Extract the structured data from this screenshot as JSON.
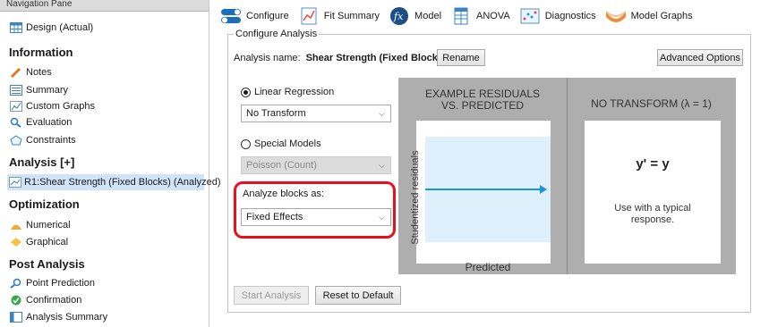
{
  "nav": {
    "title": "Navigation Pane",
    "design": "Design (Actual)",
    "info_head": "Information",
    "info_items": [
      "Notes",
      "Summary",
      "Custom Graphs",
      "Evaluation",
      "Constraints"
    ],
    "analysis_head": "Analysis [+]",
    "analysis_item": "R1:Shear Strength (Fixed Blocks) (Analyzed)",
    "opt_head": "Optimization",
    "opt_items": [
      "Numerical",
      "Graphical"
    ],
    "post_head": "Post Analysis",
    "post_items": [
      "Point Prediction",
      "Confirmation",
      "Analysis Summary"
    ]
  },
  "tabs": [
    "Configure",
    "Fit Summary",
    "Model",
    "ANOVA",
    "Diagnostics",
    "Model Graphs"
  ],
  "configure": {
    "legend": "Configure Analysis",
    "name_label": "Analysis name:",
    "name_value": "Shear Strength (Fixed Blocks)",
    "rename": "Rename",
    "advanced": "Advanced Options",
    "linear": "Linear Regression",
    "transform": "No Transform",
    "special": "Special Models",
    "special_value": "Poisson (Count)",
    "blocks_label": "Analyze blocks as:",
    "blocks_value": "Fixed Effects",
    "start": "Start Analysis",
    "reset": "Reset to Default"
  },
  "diagram": {
    "left_title_1": "EXAMPLE RESIDUALS",
    "left_title_2": "VS. PREDICTED",
    "y_label": "Studentized residuals",
    "x_label": "Predicted",
    "right_title": "NO TRANSFORM (λ = 1)",
    "equation": "y' = y",
    "desc": "Use with a typical response."
  },
  "colors": {
    "accent": "#1e90e0",
    "highlight": "#e8101b",
    "selection": "#cfe4f8"
  }
}
